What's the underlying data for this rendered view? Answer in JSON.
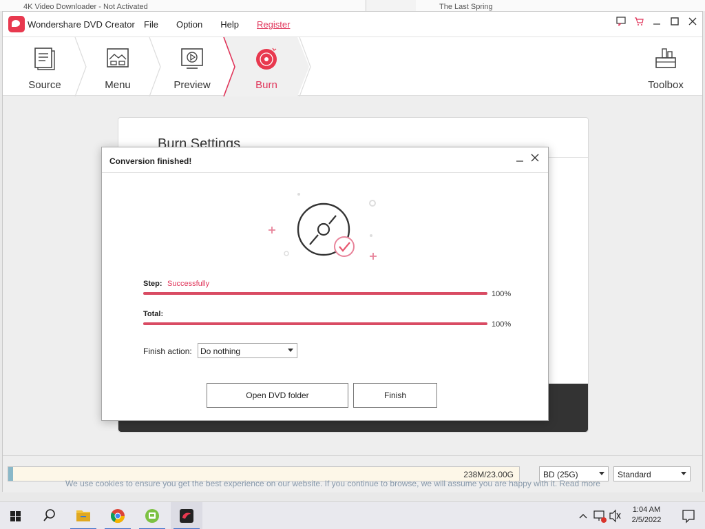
{
  "background_windows": {
    "left_title": "4K Video Downloader - Not Activated",
    "right_title": "The Last Spring"
  },
  "app": {
    "title": "Wondershare DVD Creator",
    "menu": [
      "File",
      "Option",
      "Help",
      "Register"
    ],
    "steps": [
      {
        "label": "Source",
        "icon": "source-document-icon"
      },
      {
        "label": "Menu",
        "icon": "menu-template-icon"
      },
      {
        "label": "Preview",
        "icon": "preview-play-icon"
      },
      {
        "label": "Burn",
        "icon": "burn-disc-icon",
        "active": true
      }
    ],
    "toolbox_label": "Toolbox"
  },
  "panel": {
    "title": "Burn Settings"
  },
  "dialog": {
    "title": "Conversion finished!",
    "step_label": "Step:",
    "step_status": "Successfully",
    "step_progress": 100,
    "step_percent": "100%",
    "total_label": "Total:",
    "total_progress": 100,
    "total_percent": "100%",
    "finish_action_label": "Finish action:",
    "finish_action_value": "Do nothing",
    "open_folder_button": "Open DVD folder",
    "finish_button": "Finish"
  },
  "statusbar": {
    "capacity_text": "238M/23.00G",
    "capacity_fraction": 0.0101,
    "disc_type": "BD (25G)",
    "quality": "Standard"
  },
  "cookie_notice": "We use cookies to ensure you get the best experience on our website. If you continue to browse, we will assume you are happy with it. Read more",
  "taskbar": {
    "time": "1:04 AM",
    "date": "2/5/2022"
  },
  "colors": {
    "accent": "#e0355a",
    "progress": "#d94b63",
    "dark_panel": "#333333"
  }
}
